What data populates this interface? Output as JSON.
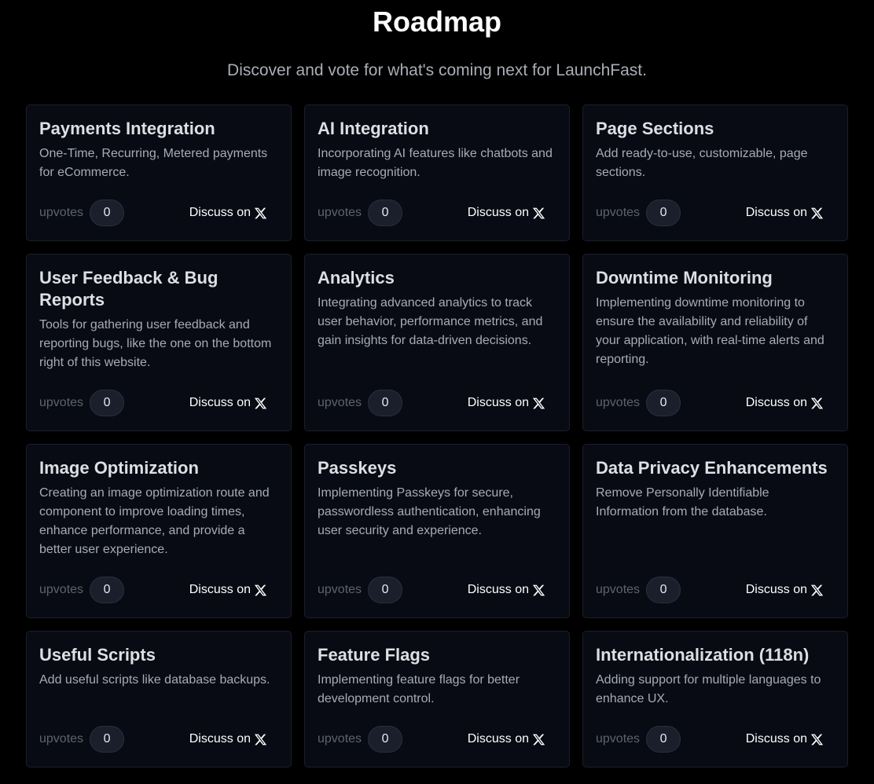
{
  "header": {
    "title": "Roadmap",
    "subtitle": "Discover and vote for what's coming next for LaunchFast."
  },
  "labels": {
    "upvotes": "upvotes",
    "discuss": "Discuss on"
  },
  "icons": {
    "discuss": "x-logo-icon"
  },
  "colors": {
    "background": "#000000",
    "card": "#080b13",
    "pill": "#1a1f2b"
  },
  "cards": [
    {
      "title": "Payments Integration",
      "description": "One-Time, Recurring, Metered payments for eCommerce.",
      "votes": "0"
    },
    {
      "title": "AI Integration",
      "description": "Incorporating AI features like chatbots and image recognition.",
      "votes": "0"
    },
    {
      "title": "Page Sections",
      "description": "Add ready-to-use, customizable, page sections.",
      "votes": "0"
    },
    {
      "title": "User Feedback & Bug Reports",
      "description": "Tools for gathering user feedback and reporting bugs, like the one on the bottom right of this website.",
      "votes": "0"
    },
    {
      "title": "Analytics",
      "description": "Integrating advanced analytics to track user behavior, performance metrics, and gain insights for data-driven decisions.",
      "votes": "0"
    },
    {
      "title": "Downtime Monitoring",
      "description": "Implementing downtime monitoring to ensure the availability and reliability of your application, with real-time alerts and reporting.",
      "votes": "0"
    },
    {
      "title": "Image Optimization",
      "description": "Creating an image optimization route and component to improve loading times, enhance performance, and provide a better user experience.",
      "votes": "0"
    },
    {
      "title": "Passkeys",
      "description": "Implementing Passkeys for secure, passwordless authentication, enhancing user security and experience.",
      "votes": "0"
    },
    {
      "title": "Data Privacy Enhancements",
      "description": "Remove Personally Identifiable Information from the database.",
      "votes": "0"
    },
    {
      "title": "Useful Scripts",
      "description": "Add useful scripts like database backups.",
      "votes": "0"
    },
    {
      "title": "Feature Flags",
      "description": "Implementing feature flags for better development control.",
      "votes": "0"
    },
    {
      "title": "Internationalization (118n)",
      "description": "Adding support for multiple languages to enhance UX.",
      "votes": "0"
    }
  ]
}
